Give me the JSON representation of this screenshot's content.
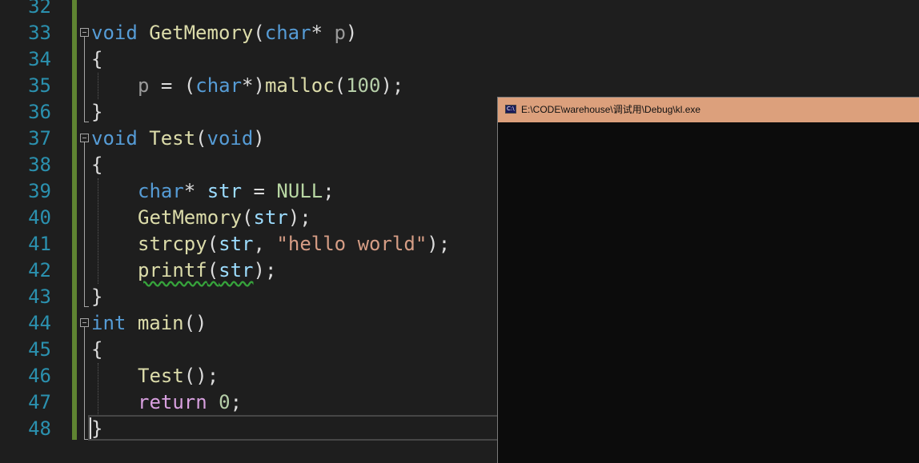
{
  "editor": {
    "line_numbers": [
      "32",
      "33",
      "34",
      "35",
      "36",
      "37",
      "38",
      "39",
      "40",
      "41",
      "42",
      "43",
      "44",
      "45",
      "46",
      "47",
      "48"
    ],
    "colors": {
      "background": "#1e1e1e",
      "line_number": "#2b91af",
      "keyword": "#569cd6",
      "function": "#dcdcaa",
      "string": "#d69d85",
      "number": "#b5cea8",
      "macro": "#b8d7a3",
      "control_keyword": "#d8a0df",
      "change_bar": "#5f8432"
    },
    "code": {
      "l33": {
        "kw_void": "void",
        "fn": "GetMemory",
        "open": "(",
        "kw_char": "char",
        "star": "*",
        "param": "p",
        "close": ")"
      },
      "l34": {
        "brace": "{"
      },
      "l35": {
        "p": "p",
        "eq": " = (",
        "kw_char": "char",
        "cast_close": "*)",
        "fn": "malloc",
        "open": "(",
        "num": "100",
        "close": ");"
      },
      "l36": {
        "brace": "}"
      },
      "l37": {
        "kw_void": "void",
        "fn": "Test",
        "open": "(",
        "kw_void2": "void",
        "close": ")"
      },
      "l38": {
        "brace": "{"
      },
      "l39": {
        "kw_char": "char",
        "star": "*",
        "var": "str",
        "eq": " = ",
        "macro": "NULL",
        "semi": ";"
      },
      "l40": {
        "fn": "GetMemory",
        "open": "(",
        "var": "str",
        "close": ");"
      },
      "l41": {
        "fn": "strcpy",
        "open": "(",
        "var": "str",
        "comma": ", ",
        "str": "\"hello world\"",
        "close": ");"
      },
      "l42": {
        "fn": "printf",
        "open": "(",
        "var": "str",
        "close": ");"
      },
      "l43": {
        "brace": "}"
      },
      "l44": {
        "kw_int": "int",
        "fn": "main",
        "parens": "()"
      },
      "l45": {
        "brace": "{"
      },
      "l46": {
        "fn": "Test",
        "rest": "();"
      },
      "l47": {
        "kw_return": "return",
        "num": "0",
        "semi": ";"
      },
      "l48": {
        "brace": "}"
      }
    }
  },
  "console": {
    "title": "E:\\CODE\\warehouse\\调试用\\Debug\\kl.exe",
    "icon": "console-app-icon",
    "icon_text": "C:\\",
    "titlebar_color": "#dca07c",
    "body_color": "#0c0c0c"
  }
}
